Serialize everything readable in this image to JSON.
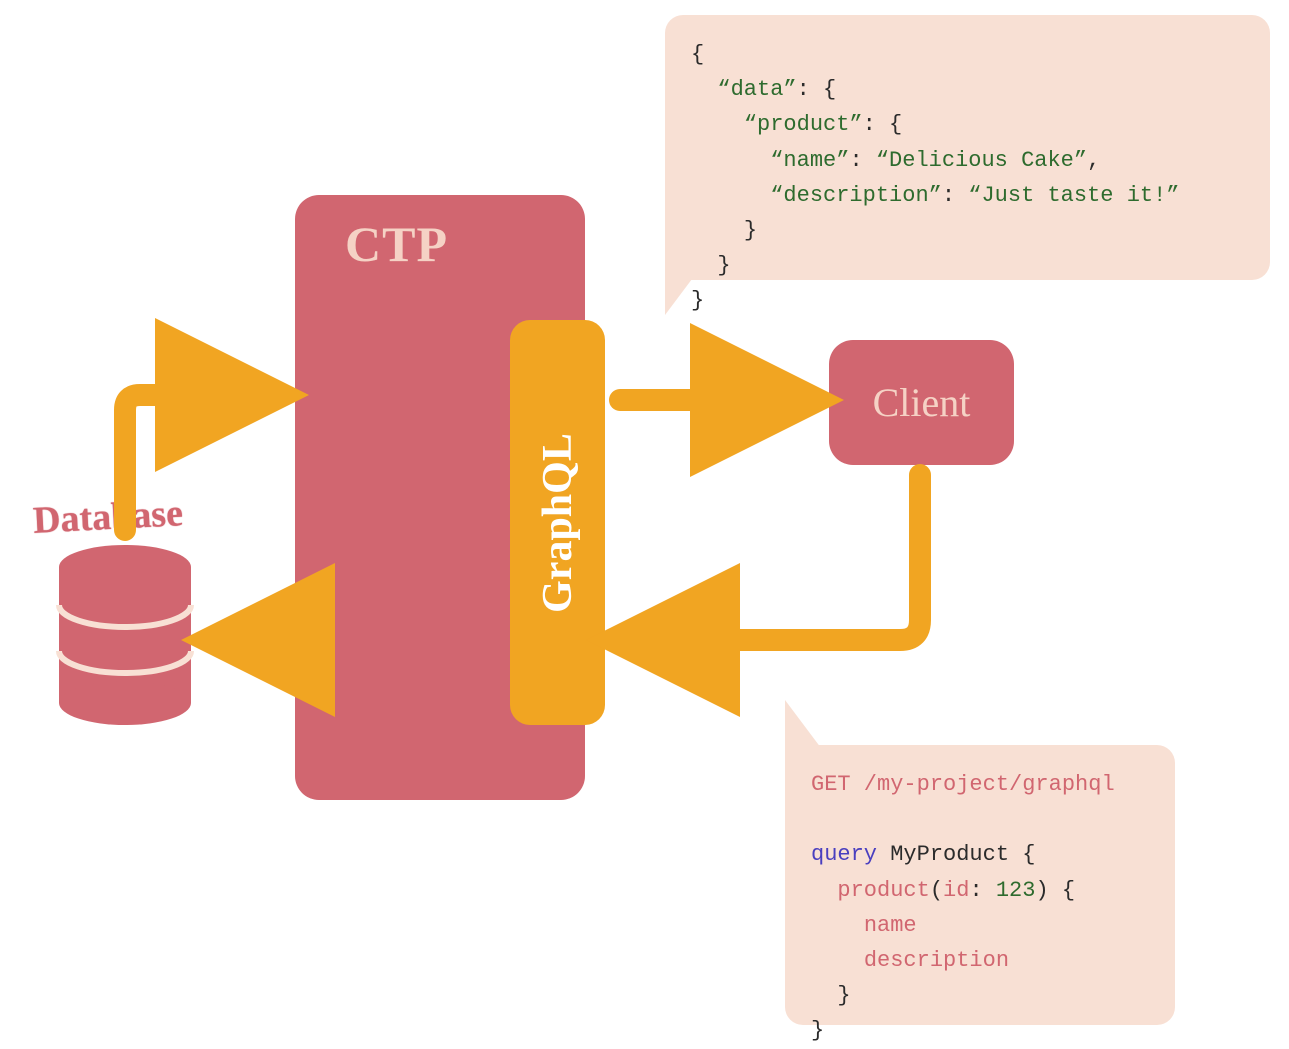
{
  "diagram": {
    "database_label": "Database",
    "ctp_label": "CTP",
    "graphql_label": "GraphQL",
    "client_label": "Client"
  },
  "response": {
    "line1": "{",
    "line2_key": "“data”",
    "line2_rest": ": {",
    "line3_key": "“product”",
    "line3_rest": ": {",
    "line4_key": "“name”",
    "line4_val": "“Delicious Cake”",
    "line5_key": "“description”",
    "line5_val": "“Just taste it!”",
    "line6": "}",
    "line7": "}",
    "line8": "}"
  },
  "request": {
    "get_line": "GET /my-project/graphql",
    "kw": "query",
    "op_name": "MyProduct",
    "field_root": "product",
    "arg_name": "id",
    "arg_value": "123",
    "sel1": "name",
    "sel2": "description",
    "brace_open": "{",
    "brace_close": "}",
    "paren_open": "(",
    "paren_close": ")",
    "colon": ":",
    "comma": ","
  },
  "colors": {
    "primary_red": "#d16670",
    "orange": "#f1a522",
    "peach": "#f8e0d4",
    "cream_text": "#f5d2c5",
    "code_green": "#2e6b2e",
    "code_purple": "#4a3fbf"
  }
}
